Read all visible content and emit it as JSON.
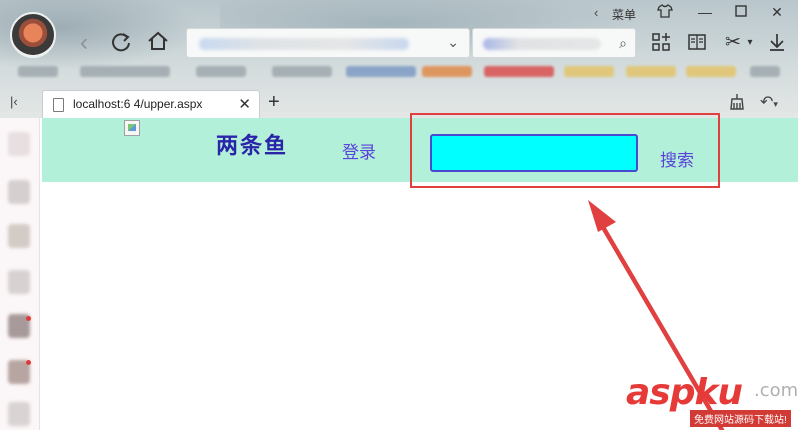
{
  "browser": {
    "menu_label": "菜单",
    "tab": {
      "title": "localhost:6  4/upper.aspx"
    }
  },
  "page": {
    "site_title": "两条鱼",
    "login_link": "登录",
    "search_input_value": "",
    "search_link": "搜索",
    "header_bg": "#b3f0d9",
    "input_bg": "#00ffff"
  },
  "annotation": {
    "color": "#e0403f"
  },
  "watermark": {
    "brand": "aspku",
    "domain_suffix": ".com",
    "subtitle": "免费网站源码下载站!"
  }
}
